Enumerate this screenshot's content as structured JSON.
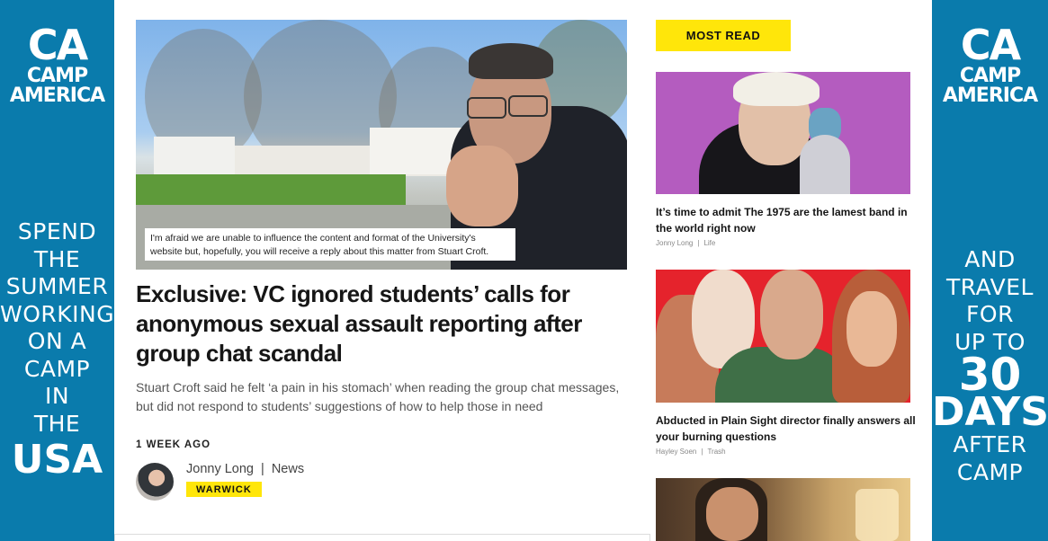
{
  "left_ad": {
    "logo_mark": "CA",
    "logo_line1": "CAMP",
    "logo_line2": "AMERICA",
    "lines": [
      "SPEND",
      "THE",
      "SUMMER",
      "WORKING",
      "ON A",
      "CAMP",
      "IN",
      "THE",
      "USA"
    ],
    "background_color": "#0a7bac"
  },
  "right_ad": {
    "logo_mark": "CA",
    "logo_line1": "CAMP",
    "logo_line2": "AMERICA",
    "lines": [
      "AND",
      "TRAVEL",
      "FOR",
      "UP TO",
      "30",
      "DAYS",
      "AFTER",
      "CAMP"
    ],
    "background_color": "#0a7bac"
  },
  "article": {
    "image_caption": "I'm afraid we are unable to influence the content and format of the University's website but, hopefully, you will receive a reply about this matter from Stuart Croft.",
    "headline": "Exclusive: VC ignored students’ calls for anonymous sexual assault reporting after group chat scandal",
    "standfirst": "Stuart Croft said he felt ‘a pain in his stomach’ when reading the group chat messages, but did not respond to students’ suggestions of how to help those in need",
    "time_ago": "1 WEEK AGO",
    "author": "Jonny Long",
    "separator": "|",
    "section": "News",
    "tag": "WARWICK",
    "tag_color": "#ffe60a"
  },
  "most_read": {
    "label": "MOST READ",
    "items": [
      {
        "title": "It’s time to admit The 1975 are the lamest band in the world right now",
        "author": "Jonny Long",
        "separator": "|",
        "section": "Life"
      },
      {
        "title": "Abducted in Plain Sight director finally answers all your burning questions",
        "author": "Hayley Soen",
        "separator": "|",
        "section": "Trash"
      }
    ]
  }
}
